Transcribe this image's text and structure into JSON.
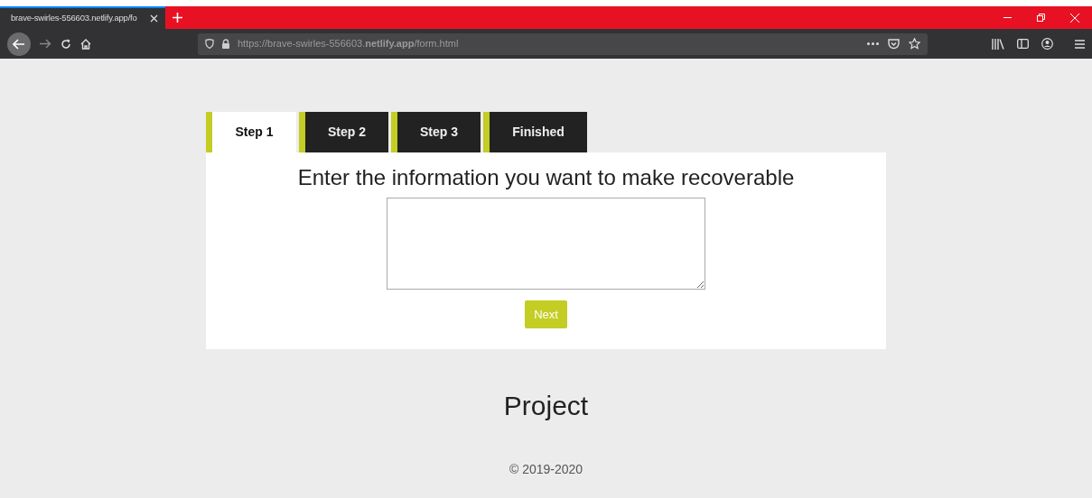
{
  "browser": {
    "tab_title": "brave-swirles-556603.netlify.app/fo",
    "url": "https://brave-swirles-556603.**netlify.app**/form.html"
  },
  "tabs": [
    {
      "label": "Step 1",
      "selected": true
    },
    {
      "label": "Step 2",
      "selected": false
    },
    {
      "label": "Step 3",
      "selected": false
    },
    {
      "label": "Finished",
      "selected": false
    }
  ],
  "form": {
    "heading": "Enter the information you want to make recoverable",
    "button": "Next"
  },
  "footer": {
    "title": "Project",
    "copyright": "© 2019-2020"
  }
}
